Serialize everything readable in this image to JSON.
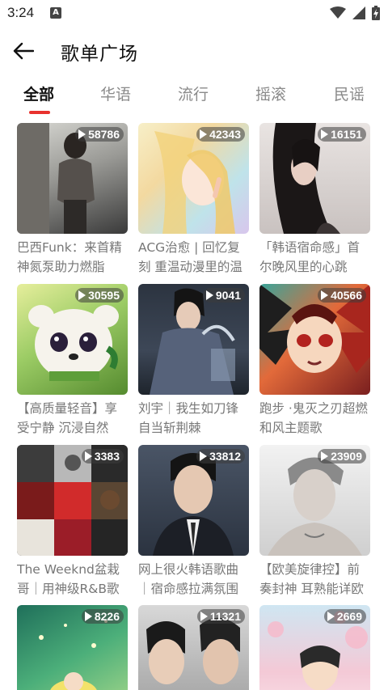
{
  "status": {
    "time": "3:24",
    "notif_letter": "A"
  },
  "header": {
    "title": "歌单广场"
  },
  "tabs": [
    "全部",
    "华语",
    "流行",
    "摇滚",
    "民谣"
  ],
  "playlists": [
    {
      "count": "58786",
      "title": "巴西Funk：来首精神氮泵助力燃脂"
    },
    {
      "count": "42343",
      "title": "ACG治愈 | 回忆复刻 重温动漫里的温"
    },
    {
      "count": "16151",
      "title": "「韩语宿命感」首尔晚风里的心跳"
    },
    {
      "count": "30595",
      "title": "【高质量轻音】享受宁静 沉浸自然"
    },
    {
      "count": "9041",
      "title": "刘宇｜我生如刀锋自当斩荆棘"
    },
    {
      "count": "40566",
      "title": "跑步 ·鬼灭之刃超燃和风主题歌"
    },
    {
      "count": "3383",
      "title": "The Weeknd盆栽哥｜用神级R&B歌声"
    },
    {
      "count": "33812",
      "title": "网上很火韩语歌曲｜宿命感拉满氛围"
    },
    {
      "count": "23909",
      "title": "【欧美旋律控】前奏封神 耳熟能详欧"
    },
    {
      "count": "8226",
      "title": ""
    },
    {
      "count": "11321",
      "title": ""
    },
    {
      "count": "2669",
      "title": ""
    }
  ]
}
